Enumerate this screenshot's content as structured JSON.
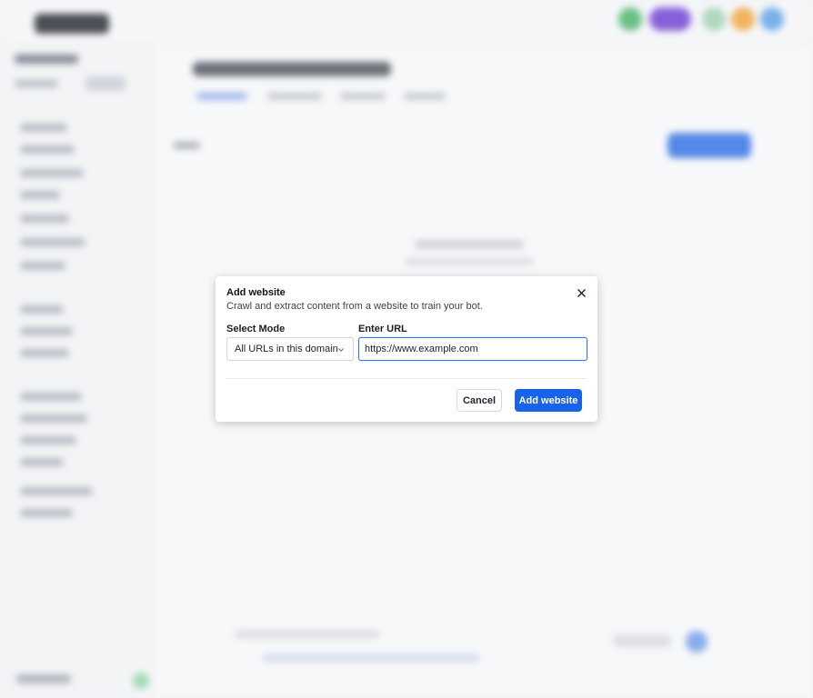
{
  "modal": {
    "title": "Add website",
    "subtitle": "Crawl and extract content from a website to train your bot.",
    "close_icon": "close-icon",
    "mode": {
      "label": "Select Mode",
      "selected": "All URLs in this domain",
      "icon": "chevron-down-icon"
    },
    "url": {
      "label": "Enter URL",
      "value": "https://www.example.com"
    },
    "buttons": {
      "cancel": "Cancel",
      "add": "Add website"
    }
  },
  "colors": {
    "primary": "#1863e8",
    "focus_border": "#3b74e6",
    "overlay": "rgba(255,255,255,0.18)"
  }
}
